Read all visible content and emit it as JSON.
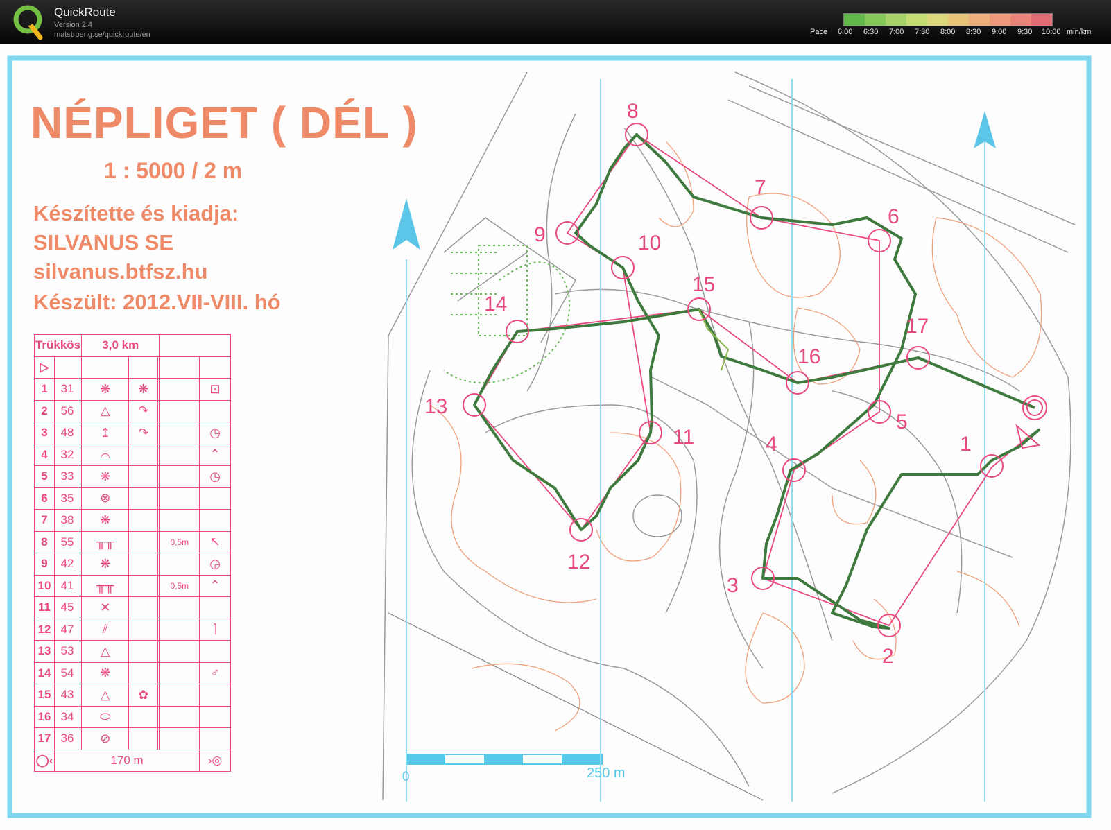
{
  "app": {
    "name": "QuickRoute",
    "version": "Version 2.4",
    "url": "matstroeng.se/quickroute/en"
  },
  "pace_legend": {
    "label": "Pace",
    "ticks": [
      "6:00",
      "6:30",
      "7:00",
      "7:30",
      "8:00",
      "8:30",
      "9:00",
      "9:30",
      "10:00"
    ],
    "unit": "min/km",
    "colors": [
      "#62b84a",
      "#86c95a",
      "#a8d36a",
      "#c6dd74",
      "#dcd77a",
      "#e9c57a",
      "#eeb07a",
      "#ee9a7a",
      "#ea8478",
      "#e46c76"
    ]
  },
  "map": {
    "title": "NÉPLIGET ( DÉL )",
    "scale": "1 : 5000 / 2 m",
    "maker_label": "Készítette és kiadja:",
    "maker_name": "SILVANUS SE",
    "maker_url": "silvanus.btfsz.hu",
    "made_date": "Készült: 2012.VII-VIII. hó",
    "scalebar_start": "0",
    "scalebar_end": "250 m",
    "colors": {
      "frame": "#7fd6ee",
      "magenta": "#e8497f",
      "route": "#3e7a3e",
      "contour": "#f0a07a",
      "north": "#5cc6e8"
    }
  },
  "description_sheet": {
    "course_name": "Trükkös",
    "course_length": "3,0 km",
    "controls": [
      {
        "no": "1",
        "code": "31",
        "c": "❋",
        "d": "❋",
        "f": "",
        "h": "⊡"
      },
      {
        "no": "2",
        "code": "56",
        "c": "△",
        "d": "↷",
        "f": "",
        "h": ""
      },
      {
        "no": "3",
        "code": "48",
        "c": "↥",
        "d": "↷",
        "f": "",
        "h": "◷"
      },
      {
        "no": "4",
        "code": "32",
        "c": "⌓",
        "d": "",
        "f": "",
        "h": "⌃"
      },
      {
        "no": "5",
        "code": "33",
        "c": "❋",
        "d": "",
        "f": "",
        "h": "◷"
      },
      {
        "no": "6",
        "code": "35",
        "c": "⊗",
        "d": "",
        "f": "",
        "h": ""
      },
      {
        "no": "7",
        "code": "38",
        "c": "❋",
        "d": "",
        "f": "",
        "h": ""
      },
      {
        "no": "8",
        "code": "55",
        "c": "╥╥",
        "d": "",
        "f": "0,5m",
        "h": "↖"
      },
      {
        "no": "9",
        "code": "42",
        "c": "❋",
        "d": "",
        "f": "",
        "h": "◶"
      },
      {
        "no": "10",
        "code": "41",
        "c": "╥╥",
        "d": "",
        "f": "0,5m",
        "h": "⌃"
      },
      {
        "no": "11",
        "code": "45",
        "c": "✕",
        "d": "",
        "f": "",
        "h": ""
      },
      {
        "no": "12",
        "code": "47",
        "c": "⫽",
        "d": "",
        "f": "",
        "h": "⌉"
      },
      {
        "no": "13",
        "code": "53",
        "c": "△",
        "d": "",
        "f": "",
        "h": ""
      },
      {
        "no": "14",
        "code": "54",
        "c": "❋",
        "d": "",
        "f": "",
        "h": "♂"
      },
      {
        "no": "15",
        "code": "43",
        "c": "△",
        "d": "✿",
        "f": "",
        "h": ""
      },
      {
        "no": "16",
        "code": "34",
        "c": "⬭",
        "d": "",
        "f": "",
        "h": ""
      },
      {
        "no": "17",
        "code": "36",
        "c": "⊘",
        "d": "",
        "f": "",
        "h": ""
      }
    ],
    "finish_distance": "170 m"
  },
  "control_labels": [
    "1",
    "2",
    "3",
    "4",
    "5",
    "6",
    "7",
    "8",
    "9",
    "10",
    "11",
    "12",
    "13",
    "14",
    "15",
    "16",
    "17"
  ]
}
